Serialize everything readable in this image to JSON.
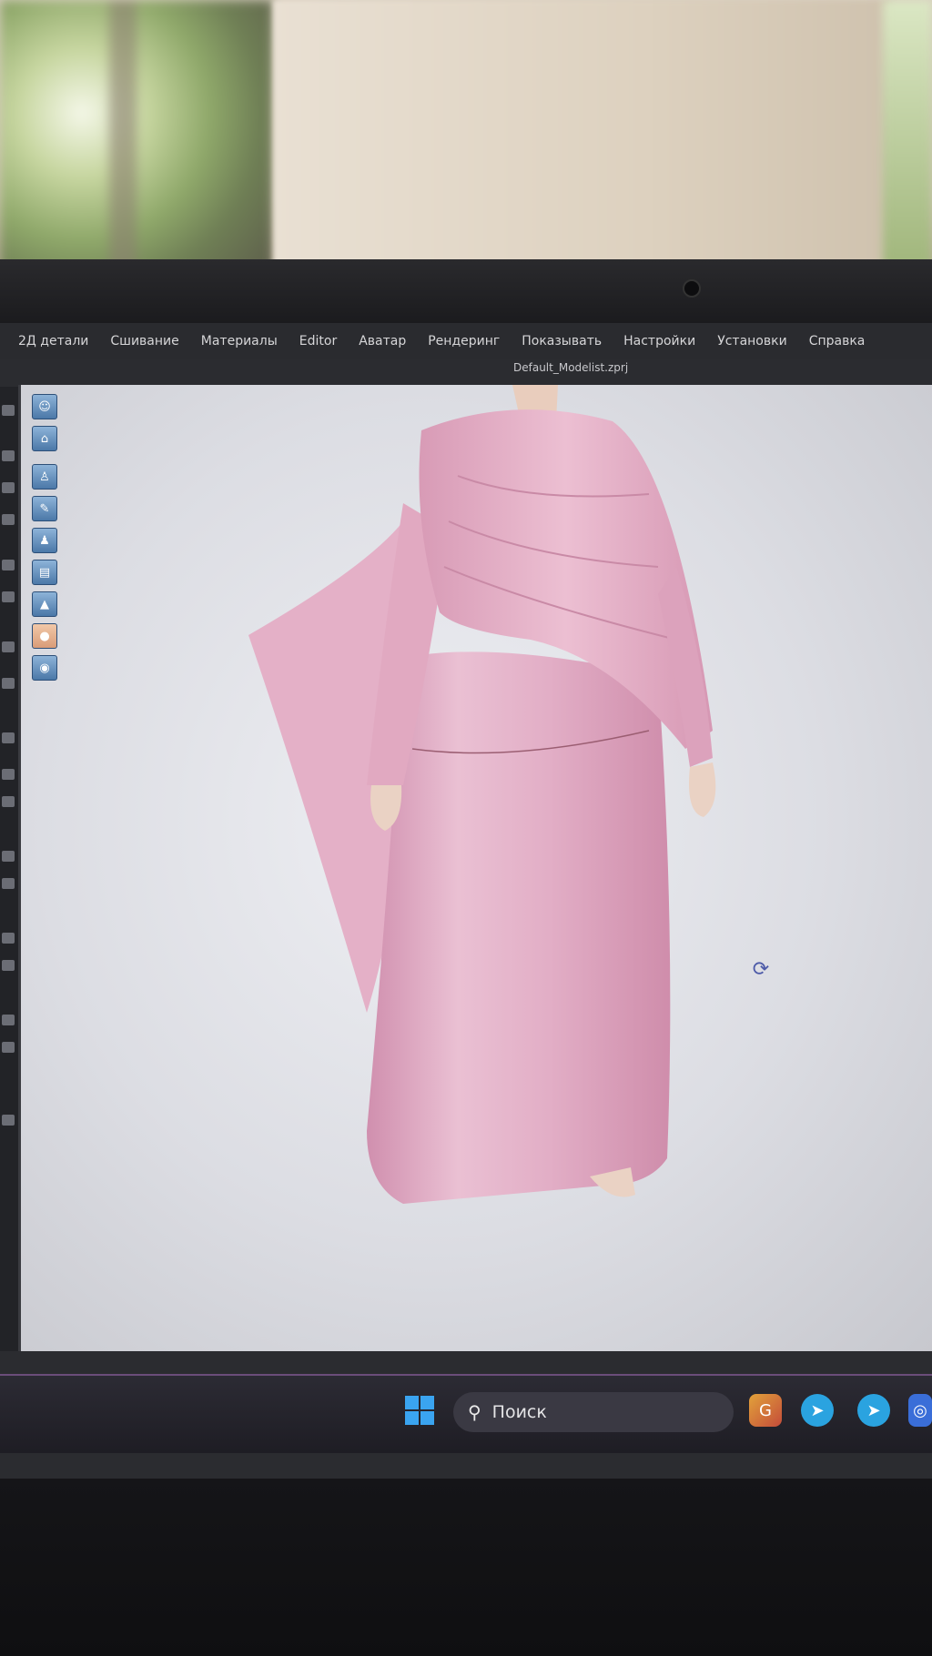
{
  "menubar": {
    "items": [
      "2Д детали",
      "Сшивание",
      "Материалы",
      "Editor",
      "Аватар",
      "Рендеринг",
      "Показывать",
      "Настройки",
      "Установки",
      "Справка"
    ]
  },
  "file_title": "Default_Modelist.zprj",
  "toolbar": {
    "tools": [
      {
        "icon": "avatar-pose-icon"
      },
      {
        "icon": "garment-icon"
      },
      {
        "icon": "shirt-icon"
      },
      {
        "icon": "brush-icon"
      },
      {
        "icon": "avatar-icon"
      },
      {
        "icon": "layer-icon"
      },
      {
        "icon": "hanger-icon"
      },
      {
        "icon": "skin-icon"
      },
      {
        "icon": "globe-icon"
      }
    ]
  },
  "taskbar": {
    "search_placeholder": "Поиск"
  },
  "colors": {
    "garment": "#e6b3c9",
    "accent": "#3aa4f0"
  }
}
